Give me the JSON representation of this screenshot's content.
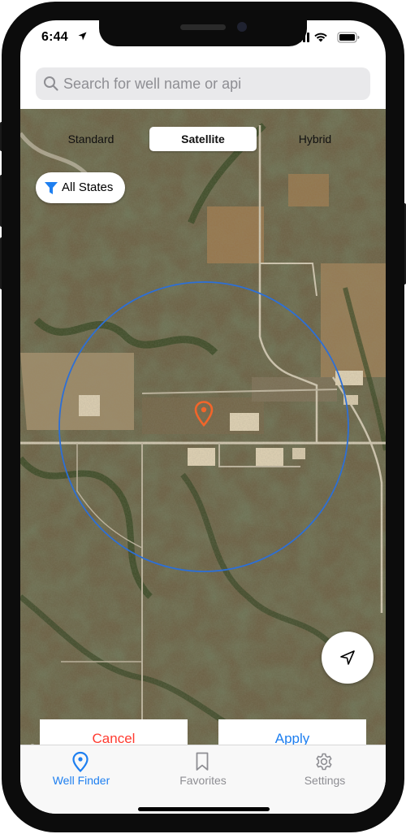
{
  "status_bar": {
    "time": "6:44"
  },
  "search": {
    "placeholder": "Search for well name or api"
  },
  "map_types": {
    "items": [
      "Standard",
      "Satellite",
      "Hybrid"
    ],
    "selected": "Satellite"
  },
  "filter": {
    "label": "All States"
  },
  "actions": {
    "cancel_label": "Cancel",
    "apply_label": "Apply"
  },
  "tabs": [
    {
      "label": "Well Finder",
      "icon": "map-pin-icon",
      "active": true
    },
    {
      "label": "Favorites",
      "icon": "bookmark-icon",
      "active": false
    },
    {
      "label": "Settings",
      "icon": "gear-icon",
      "active": false
    }
  ],
  "colors": {
    "accent": "#1e7ff0",
    "cancel": "#ff3b30",
    "radius_circle": "#2d6fd6",
    "pin": "#f2652a",
    "tab_inactive": "#8e8e93"
  }
}
